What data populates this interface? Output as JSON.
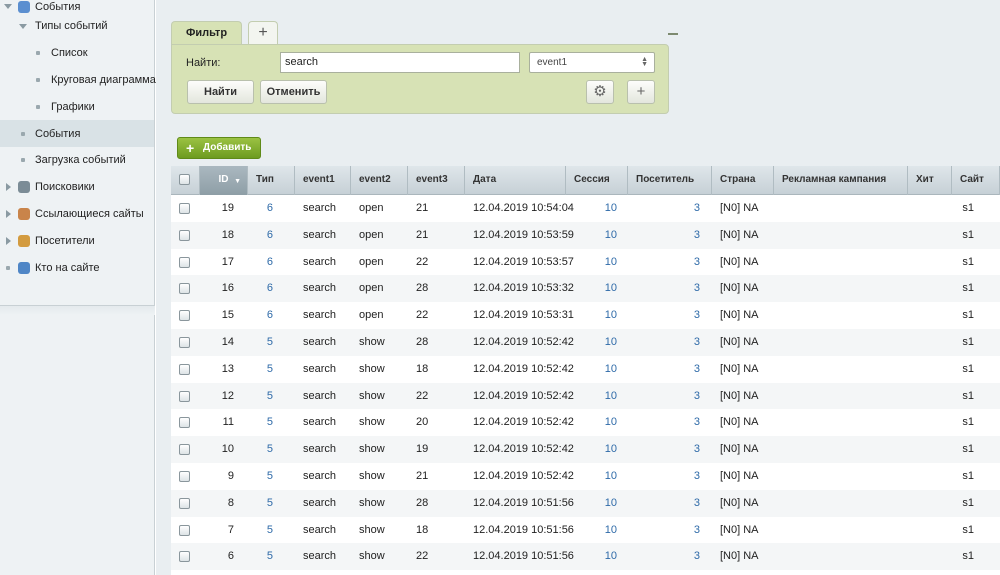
{
  "sidebar": {
    "items": [
      {
        "label": "События",
        "kind": "root",
        "icon": "events-icon"
      },
      {
        "label": "Типы событий",
        "kind": "expanded"
      },
      {
        "label": "Список",
        "kind": "sub"
      },
      {
        "label": "Круговая диаграмма",
        "kind": "sub"
      },
      {
        "label": "Графики",
        "kind": "sub"
      },
      {
        "label": "События",
        "kind": "child-active"
      },
      {
        "label": "Загрузка событий",
        "kind": "child"
      },
      {
        "label": "Поисковики",
        "kind": "collapsed",
        "icon": "search-engines-icon"
      },
      {
        "label": "Ссылающиеся сайты",
        "kind": "collapsed",
        "icon": "referring-sites-icon"
      },
      {
        "label": "Посетители",
        "kind": "collapsed",
        "icon": "visitors-icon"
      },
      {
        "label": "Кто на сайте",
        "kind": "leaf",
        "icon": "who-online-icon"
      }
    ]
  },
  "filter": {
    "tab_label": "Фильтр",
    "add_tab_label": "+",
    "find_label": "Найти:",
    "find_value": "search",
    "select_value": "event1",
    "find_button": "Найти",
    "cancel_button": "Отменить",
    "plus_button": "+"
  },
  "toolbar": {
    "add_label": "Добавить"
  },
  "grid": {
    "columns": [
      "ID",
      "Тип",
      "event1",
      "event2",
      "event3",
      "Дата",
      "Сессия",
      "Посетитель",
      "Страна",
      "Рекламная кампания",
      "Хит",
      "Сайт"
    ],
    "sorted_column": "ID",
    "rows": [
      {
        "id": "19",
        "type": "6",
        "e1": "search",
        "e2": "open",
        "e3": "21",
        "date": "12.04.2019 10:54:04",
        "session": "10",
        "visitor": "3",
        "country": "[N0] NA",
        "site": "s1"
      },
      {
        "id": "18",
        "type": "6",
        "e1": "search",
        "e2": "open",
        "e3": "21",
        "date": "12.04.2019 10:53:59",
        "session": "10",
        "visitor": "3",
        "country": "[N0] NA",
        "site": "s1"
      },
      {
        "id": "17",
        "type": "6",
        "e1": "search",
        "e2": "open",
        "e3": "22",
        "date": "12.04.2019 10:53:57",
        "session": "10",
        "visitor": "3",
        "country": "[N0] NA",
        "site": "s1"
      },
      {
        "id": "16",
        "type": "6",
        "e1": "search",
        "e2": "open",
        "e3": "28",
        "date": "12.04.2019 10:53:32",
        "session": "10",
        "visitor": "3",
        "country": "[N0] NA",
        "site": "s1"
      },
      {
        "id": "15",
        "type": "6",
        "e1": "search",
        "e2": "open",
        "e3": "22",
        "date": "12.04.2019 10:53:31",
        "session": "10",
        "visitor": "3",
        "country": "[N0] NA",
        "site": "s1"
      },
      {
        "id": "14",
        "type": "5",
        "e1": "search",
        "e2": "show",
        "e3": "28",
        "date": "12.04.2019 10:52:42",
        "session": "10",
        "visitor": "3",
        "country": "[N0] NA",
        "site": "s1"
      },
      {
        "id": "13",
        "type": "5",
        "e1": "search",
        "e2": "show",
        "e3": "18",
        "date": "12.04.2019 10:52:42",
        "session": "10",
        "visitor": "3",
        "country": "[N0] NA",
        "site": "s1"
      },
      {
        "id": "12",
        "type": "5",
        "e1": "search",
        "e2": "show",
        "e3": "22",
        "date": "12.04.2019 10:52:42",
        "session": "10",
        "visitor": "3",
        "country": "[N0] NA",
        "site": "s1"
      },
      {
        "id": "11",
        "type": "5",
        "e1": "search",
        "e2": "show",
        "e3": "20",
        "date": "12.04.2019 10:52:42",
        "session": "10",
        "visitor": "3",
        "country": "[N0] NA",
        "site": "s1"
      },
      {
        "id": "10",
        "type": "5",
        "e1": "search",
        "e2": "show",
        "e3": "19",
        "date": "12.04.2019 10:52:42",
        "session": "10",
        "visitor": "3",
        "country": "[N0] NA",
        "site": "s1"
      },
      {
        "id": "9",
        "type": "5",
        "e1": "search",
        "e2": "show",
        "e3": "21",
        "date": "12.04.2019 10:52:42",
        "session": "10",
        "visitor": "3",
        "country": "[N0] NA",
        "site": "s1"
      },
      {
        "id": "8",
        "type": "5",
        "e1": "search",
        "e2": "show",
        "e3": "28",
        "date": "12.04.2019 10:51:56",
        "session": "10",
        "visitor": "3",
        "country": "[N0] NA",
        "site": "s1"
      },
      {
        "id": "7",
        "type": "5",
        "e1": "search",
        "e2": "show",
        "e3": "18",
        "date": "12.04.2019 10:51:56",
        "session": "10",
        "visitor": "3",
        "country": "[N0] NA",
        "site": "s1"
      },
      {
        "id": "6",
        "type": "5",
        "e1": "search",
        "e2": "show",
        "e3": "22",
        "date": "12.04.2019 10:51:56",
        "session": "10",
        "visitor": "3",
        "country": "[N0] NA",
        "site": "s1"
      }
    ]
  },
  "colors": {
    "accent_green": "#7aa52a",
    "link_blue": "#2e6aa8",
    "filter_bg": "#d7e2b5"
  }
}
